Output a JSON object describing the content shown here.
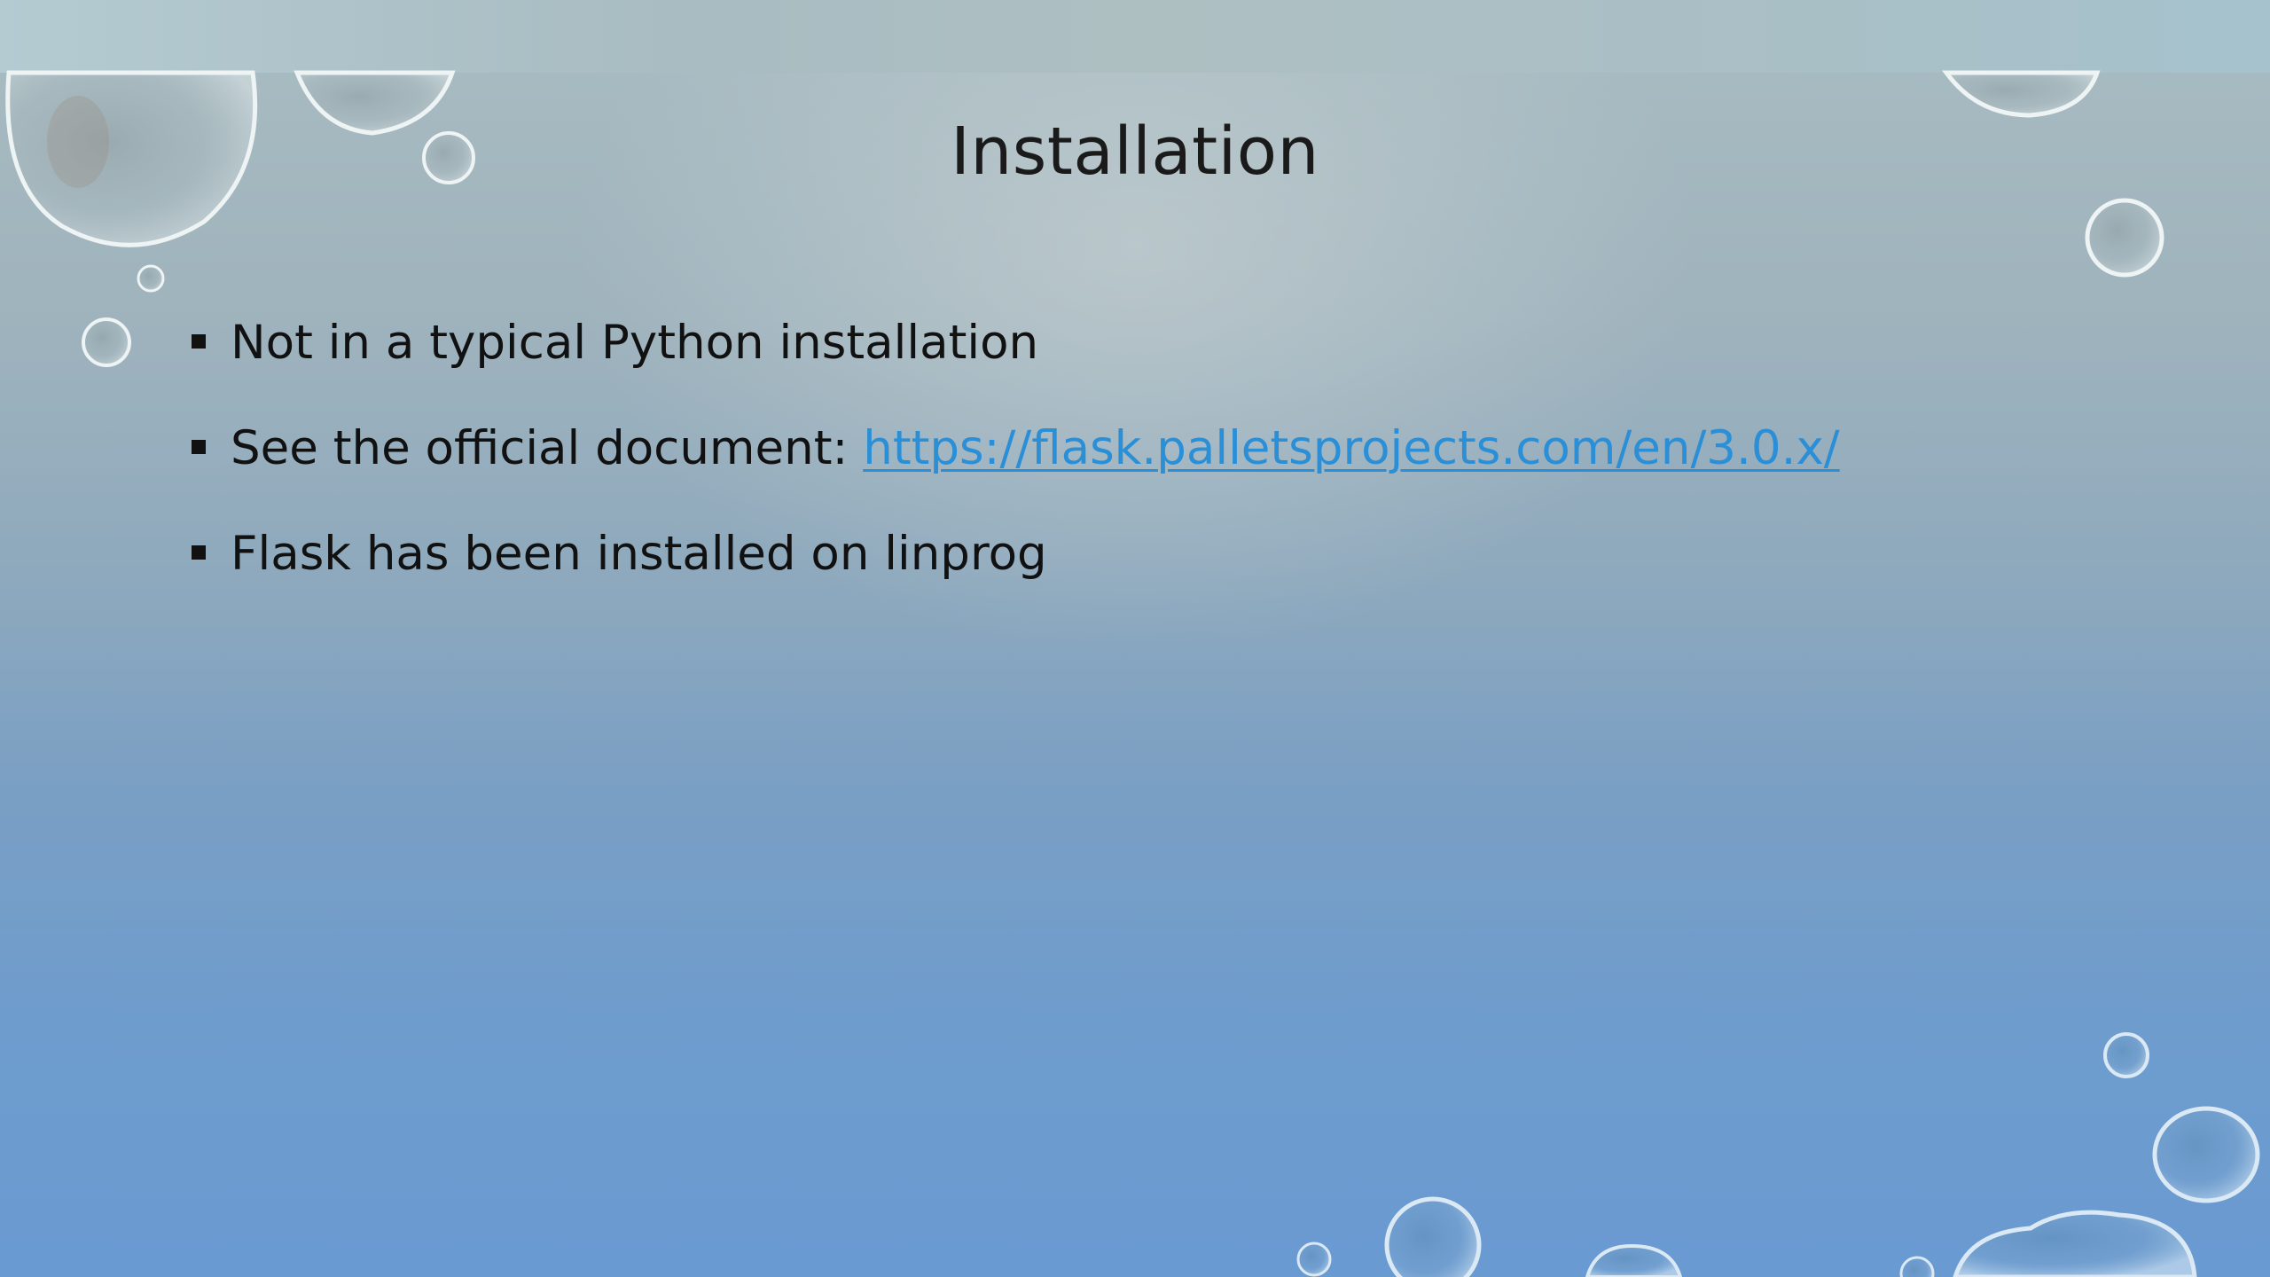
{
  "slide": {
    "title": "Installation",
    "bullets": [
      {
        "text": "Not in a typical Python installation"
      },
      {
        "text": "See the official document: ",
        "link": "https://flask.palletsprojects.com/en/3.0.x/"
      },
      {
        "text": "Flask has been installed on linprog"
      }
    ]
  },
  "theme": {
    "link_color": "#2a8fd6",
    "background_top": "#a9bcc2",
    "background_bottom": "#6a9ad2"
  }
}
